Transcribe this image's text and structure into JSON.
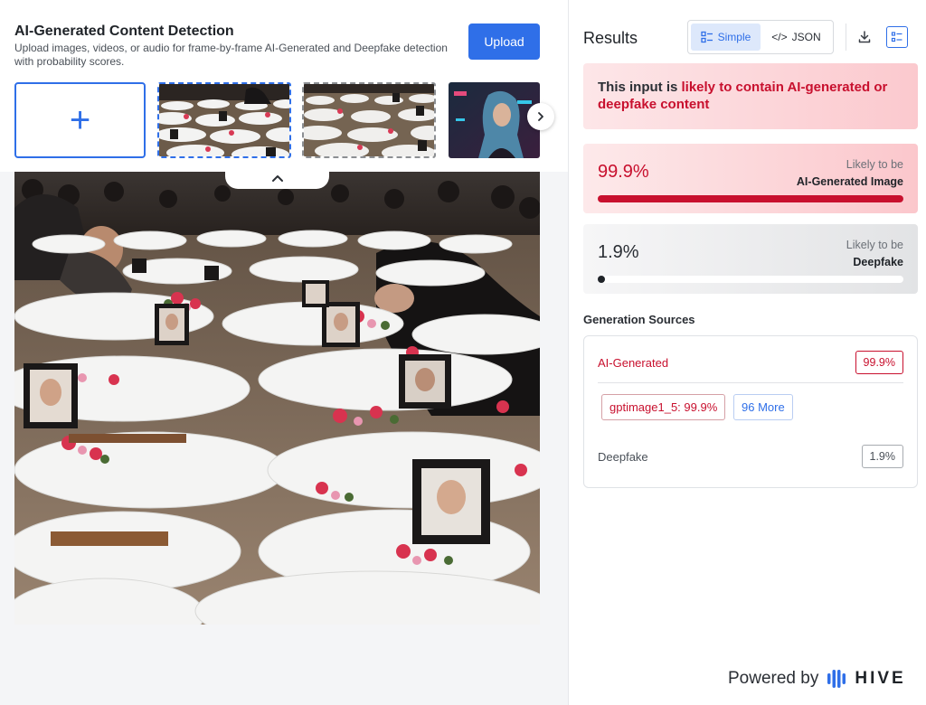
{
  "app": {
    "title": "AI-Generated Content Detection",
    "subtitle": "Upload images, videos, or audio for frame-by-frame AI-Generated and Deepfake detection with probability scores.",
    "upload_label": "Upload"
  },
  "thumbnails": [
    {
      "name": "thumb-1",
      "selected": true
    },
    {
      "name": "thumb-2",
      "selected": false
    },
    {
      "name": "thumb-3",
      "selected": false
    }
  ],
  "add_tile_symbol": "+",
  "icons": {
    "next": "chevron-right-icon",
    "collapse": "chevron-up-icon",
    "simple": "list-view-icon",
    "json": "code-icon",
    "download": "download-icon",
    "report": "report-list-icon",
    "brand": "hive-logo-icon"
  },
  "results": {
    "title": "Results",
    "view_simple": "Simple",
    "view_json": "JSON",
    "json_prefix": "</>",
    "verdict_plain": "This input is ",
    "verdict_strong": "likely to contain AI-generated or deepfake content"
  },
  "scores": {
    "ai": {
      "value": "99.9%",
      "label_1": "Likely to be",
      "label_2": "AI-Generated Image",
      "fraction": 0.999
    },
    "deepfake": {
      "value": "1.9%",
      "label_1": "Likely to be",
      "label_2": "Deepfake",
      "fraction": 0.019
    }
  },
  "sources": {
    "title": "Generation Sources",
    "ai_name": "AI-Generated",
    "ai_value": "99.9%",
    "model_tag": "gptimage1_5: 99.9%",
    "more_tag": "96 More",
    "deepfake_name": "Deepfake",
    "deepfake_value": "1.9%"
  },
  "footer": {
    "powered_by": "Powered by",
    "brand": "HIVE"
  },
  "colors": {
    "accent": "#2f6fe8",
    "danger": "#c8102e"
  }
}
